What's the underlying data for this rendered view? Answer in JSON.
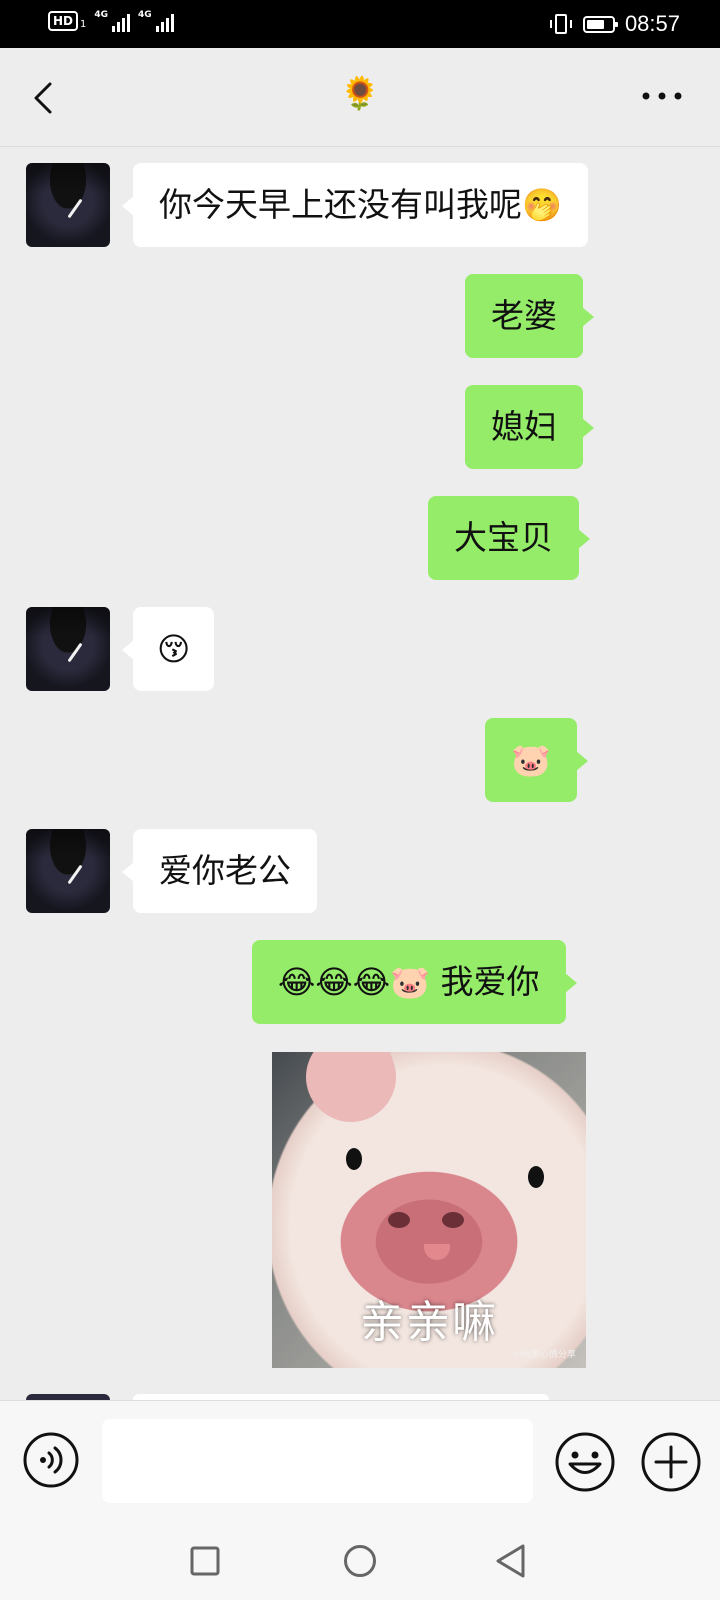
{
  "status_bar": {
    "hd_label": "HD",
    "sim_slot": "1",
    "network_1": "4G",
    "network_2": "4G",
    "time": "08:57"
  },
  "header": {
    "title": "🌻"
  },
  "messages": [
    {
      "side": "in",
      "text": "你今天早上还没有叫我呢",
      "emoji": "🤭"
    },
    {
      "side": "out",
      "text": "老婆"
    },
    {
      "side": "out",
      "text": "媳妇"
    },
    {
      "side": "out",
      "text": "大宝贝"
    },
    {
      "side": "in",
      "emoji": "😚"
    },
    {
      "side": "out",
      "emoji": "🐷"
    },
    {
      "side": "in",
      "text": "爱你老公"
    },
    {
      "side": "out",
      "emoji": "😂😂😂🐷",
      "text": "我爱你"
    },
    {
      "side": "out",
      "sticker_caption": "亲亲嘛",
      "sticker_watermark": "小玩意心情分享"
    }
  ],
  "input_bar": {
    "input_value": "",
    "placeholder": ""
  },
  "icons": {
    "back": "back-arrow-icon",
    "more": "more-dots-icon",
    "voice": "voice-icon",
    "emoji": "emoji-smile-icon",
    "plus": "plus-icon",
    "nav_recent": "square-icon",
    "nav_home": "circle-icon",
    "nav_back": "triangle-back-icon"
  },
  "colors": {
    "outgoing_bubble": "#95ec69",
    "incoming_bubble": "#ffffff",
    "chat_background": "#ededed"
  }
}
